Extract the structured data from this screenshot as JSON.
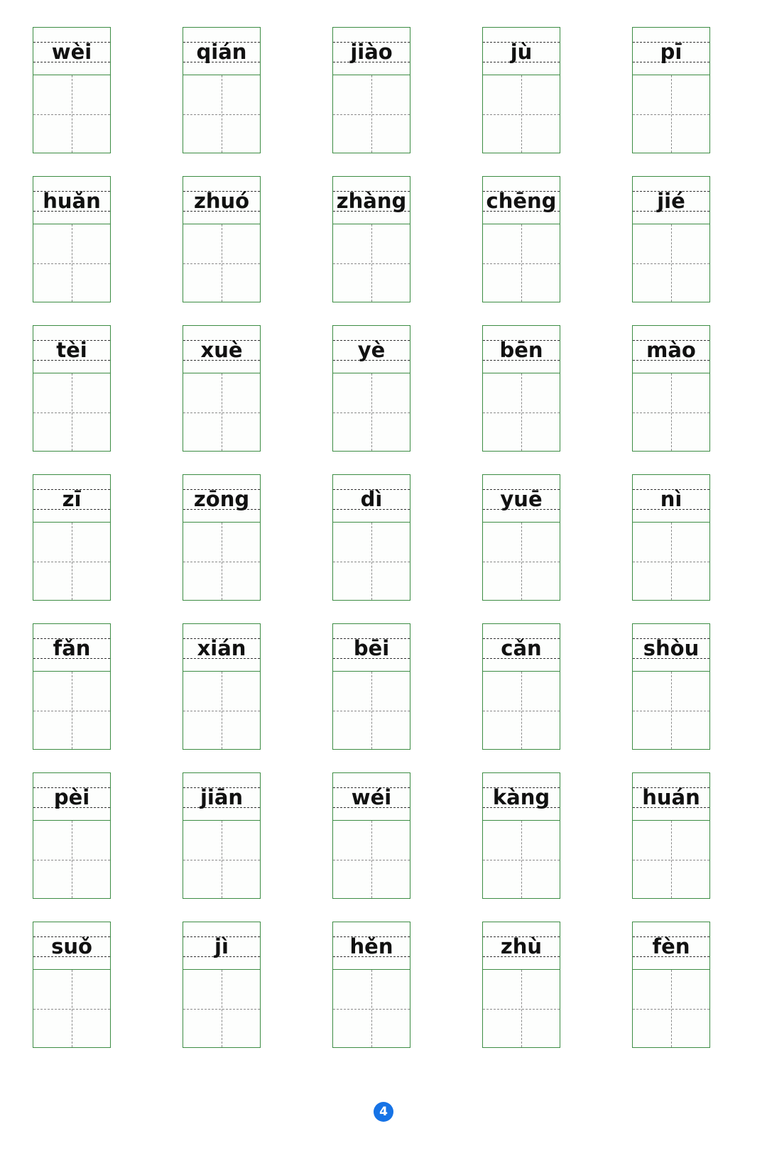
{
  "page": {
    "title": "Pinyin writing practice worksheet",
    "page_number": "4",
    "badge_color": "#1673e6",
    "grid_color": "#3c8c43",
    "guide_color": "#333333",
    "columns": 5,
    "rows": 7
  },
  "cells": [
    {
      "pinyin": "wèi",
      "character": ""
    },
    {
      "pinyin": "qián",
      "character": ""
    },
    {
      "pinyin": "jiào",
      "character": ""
    },
    {
      "pinyin": "jù",
      "character": ""
    },
    {
      "pinyin": "pī",
      "character": ""
    },
    {
      "pinyin": "huǎn",
      "character": ""
    },
    {
      "pinyin": "zhuó",
      "character": ""
    },
    {
      "pinyin": "zhàng",
      "character": ""
    },
    {
      "pinyin": "chēng",
      "character": ""
    },
    {
      "pinyin": "jié",
      "character": ""
    },
    {
      "pinyin": "tèi",
      "character": ""
    },
    {
      "pinyin": "xuè",
      "character": ""
    },
    {
      "pinyin": "yè",
      "character": ""
    },
    {
      "pinyin": "bēn",
      "character": ""
    },
    {
      "pinyin": "mào",
      "character": ""
    },
    {
      "pinyin": "zī",
      "character": ""
    },
    {
      "pinyin": "zōng",
      "character": ""
    },
    {
      "pinyin": "dì",
      "character": ""
    },
    {
      "pinyin": "yuē",
      "character": ""
    },
    {
      "pinyin": "nì",
      "character": ""
    },
    {
      "pinyin": "fǎn",
      "character": ""
    },
    {
      "pinyin": "xián",
      "character": ""
    },
    {
      "pinyin": "bēi",
      "character": ""
    },
    {
      "pinyin": "cǎn",
      "character": ""
    },
    {
      "pinyin": "shòu",
      "character": ""
    },
    {
      "pinyin": "pèi",
      "character": ""
    },
    {
      "pinyin": "jiān",
      "character": ""
    },
    {
      "pinyin": "wéi",
      "character": ""
    },
    {
      "pinyin": "kàng",
      "character": ""
    },
    {
      "pinyin": "huán",
      "character": ""
    },
    {
      "pinyin": "suǒ",
      "character": ""
    },
    {
      "pinyin": "jì",
      "character": ""
    },
    {
      "pinyin": "hěn",
      "character": ""
    },
    {
      "pinyin": "zhù",
      "character": ""
    },
    {
      "pinyin": "fèn",
      "character": ""
    }
  ]
}
